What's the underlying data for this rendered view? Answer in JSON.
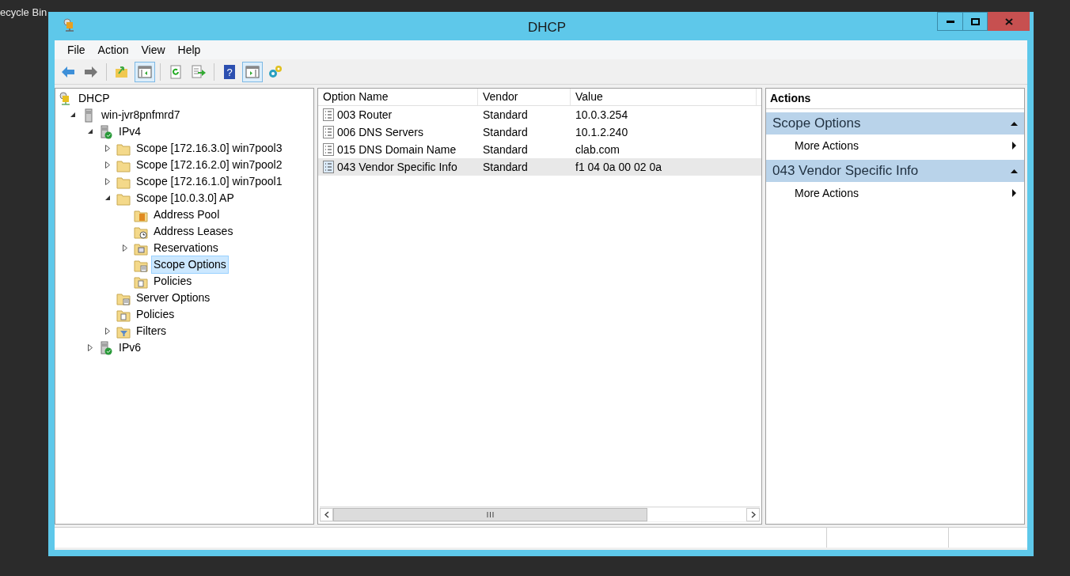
{
  "desktop": {
    "icon_label": "ecycle Bin"
  },
  "window": {
    "title": "DHCP"
  },
  "menu": [
    "File",
    "Action",
    "View",
    "Help"
  ],
  "toolbar": [
    {
      "kind": "back",
      "pressed": false
    },
    {
      "kind": "forward",
      "pressed": false
    },
    {
      "kind": "sep"
    },
    {
      "kind": "up",
      "pressed": false
    },
    {
      "kind": "tree",
      "pressed": true
    },
    {
      "kind": "sep"
    },
    {
      "kind": "refresh",
      "pressed": false
    },
    {
      "kind": "export",
      "pressed": false
    },
    {
      "kind": "sep"
    },
    {
      "kind": "help",
      "pressed": false,
      "label": "?"
    },
    {
      "kind": "actionpane",
      "pressed": true
    },
    {
      "kind": "gear",
      "pressed": false
    }
  ],
  "tree": [
    {
      "label": "DHCP",
      "kind": "dhcp",
      "selected": false,
      "children": [
        {
          "label": "win-jvr8pnfmrd7",
          "kind": "server",
          "expanded": true,
          "selected": false,
          "children": [
            {
              "label": "IPv4",
              "kind": "ipserver",
              "expanded": true,
              "selected": false,
              "children": [
                {
                  "label": "Scope [172.16.3.0] win7pool3",
                  "kind": "folder",
                  "expanded": false,
                  "selected": false
                },
                {
                  "label": "Scope [172.16.2.0] win7pool2",
                  "kind": "folder",
                  "expanded": false,
                  "selected": false
                },
                {
                  "label": "Scope [172.16.1.0] win7pool1",
                  "kind": "folder",
                  "expanded": false,
                  "selected": false
                },
                {
                  "label": "Scope [10.0.3.0] AP",
                  "kind": "folder",
                  "expanded": true,
                  "selected": false,
                  "children": [
                    {
                      "label": "Address Pool",
                      "kind": "pool",
                      "selected": false
                    },
                    {
                      "label": "Address Leases",
                      "kind": "leases",
                      "selected": false
                    },
                    {
                      "label": "Reservations",
                      "kind": "reservations",
                      "expanded": false,
                      "selected": false
                    },
                    {
                      "label": "Scope Options",
                      "kind": "options",
                      "selected": true
                    },
                    {
                      "label": "Policies",
                      "kind": "policies",
                      "selected": false
                    }
                  ]
                },
                {
                  "label": "Server Options",
                  "kind": "options",
                  "selected": false
                },
                {
                  "label": "Policies",
                  "kind": "policies",
                  "selected": false
                },
                {
                  "label": "Filters",
                  "kind": "filters",
                  "expanded": false,
                  "selected": false
                }
              ]
            },
            {
              "label": "IPv6",
              "kind": "ipserver",
              "expanded": false,
              "selected": false
            }
          ]
        }
      ]
    }
  ],
  "table": {
    "columns": [
      "Option Name",
      "Vendor",
      "Value"
    ],
    "rows": [
      {
        "cells": [
          "003 Router",
          "Standard",
          "10.0.3.254"
        ],
        "selected": false
      },
      {
        "cells": [
          "006 DNS Servers",
          "Standard",
          "10.1.2.240"
        ],
        "selected": false
      },
      {
        "cells": [
          "015 DNS Domain Name",
          "Standard",
          "clab.com"
        ],
        "selected": false
      },
      {
        "cells": [
          "043 Vendor Specific Info",
          "Standard",
          "f1 04 0a 00 02 0a"
        ],
        "selected": true
      }
    ]
  },
  "actions": {
    "title": "Actions",
    "sections": [
      {
        "title": "Scope Options",
        "expanded": true,
        "items": [
          "More Actions"
        ]
      },
      {
        "title": "043 Vendor Specific Info",
        "expanded": true,
        "items": [
          "More Actions"
        ]
      }
    ]
  }
}
